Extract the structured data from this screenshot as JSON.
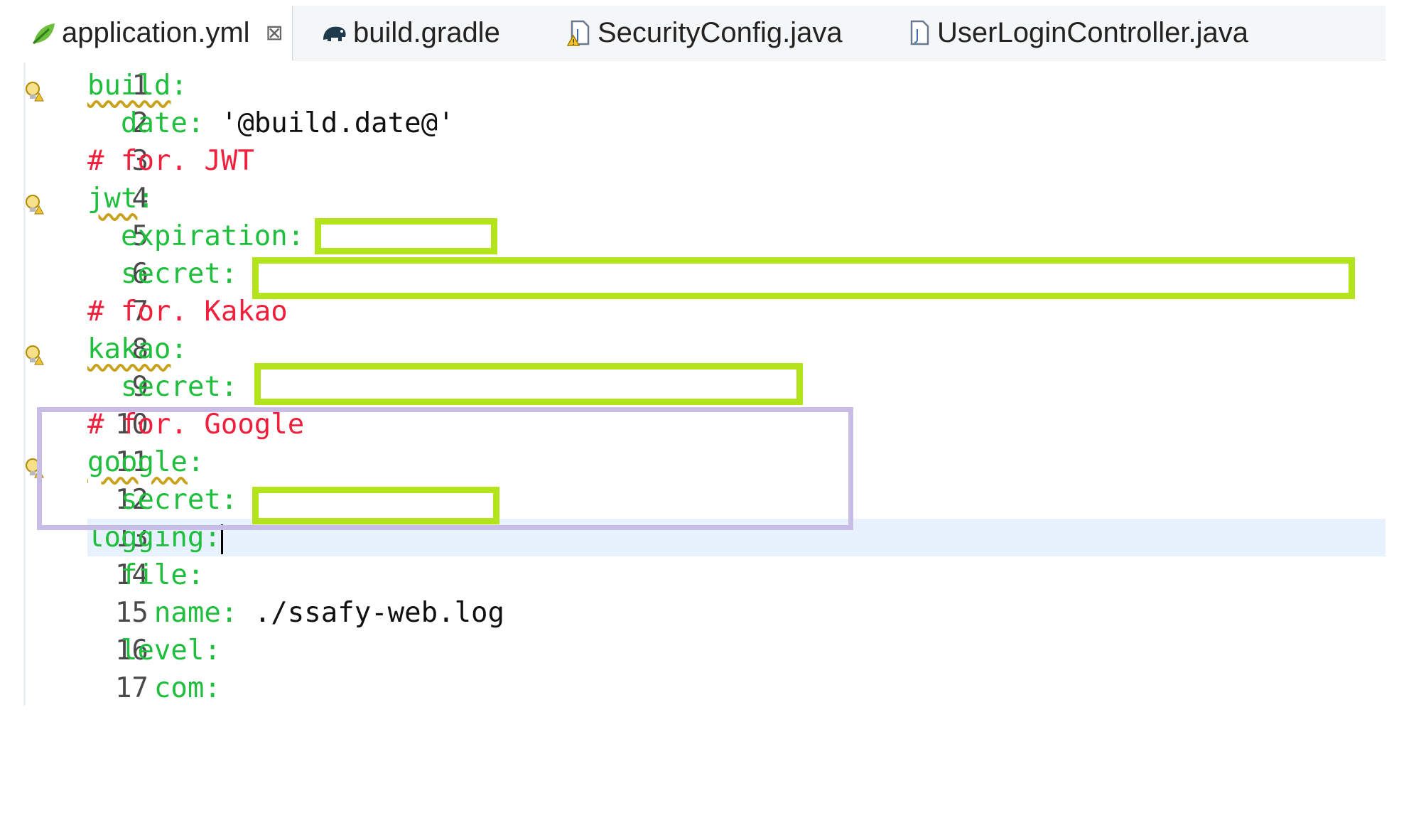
{
  "tabs": [
    {
      "label": "application.yml",
      "icon": "yaml-leaf-icon",
      "active": true,
      "close": "⊠"
    },
    {
      "label": "build.gradle",
      "icon": "gradle-elephant-icon"
    },
    {
      "label": "SecurityConfig.java",
      "icon": "java-file-warning-icon"
    },
    {
      "label": "UserLoginController.java",
      "icon": "java-file-icon"
    }
  ],
  "lines": [
    {
      "n": "1",
      "key": "build",
      "colon": ":"
    },
    {
      "n": "2",
      "key": "  date",
      "colon": ":",
      "value": " '@build.date@'"
    },
    {
      "n": "3",
      "comment": "# for. JWT"
    },
    {
      "n": "4",
      "key": "jwt",
      "colon": ":"
    },
    {
      "n": "5",
      "key": "  expiration",
      "colon": ":"
    },
    {
      "n": "6",
      "key": "  secret",
      "colon": ":"
    },
    {
      "n": "7",
      "comment": "# for. Kakao"
    },
    {
      "n": "8",
      "key": "kakao",
      "colon": ":"
    },
    {
      "n": "9",
      "key": "  secret",
      "colon": ":"
    },
    {
      "n": "10",
      "comment": "# for. Google"
    },
    {
      "n": "11",
      "key": "google",
      "colon": ":"
    },
    {
      "n": "12",
      "key": "  secret",
      "colon": ":"
    },
    {
      "n": "13",
      "key": "logging",
      "colon": ":"
    },
    {
      "n": "14",
      "key": "  file",
      "colon": ":"
    },
    {
      "n": "15",
      "key": "    name",
      "colon": ":",
      "value": " ./ssafy-web.log"
    },
    {
      "n": "16",
      "key": "  level",
      "colon": ":"
    },
    {
      "n": "17",
      "key": "    com",
      "colon": ":"
    }
  ],
  "colors": {
    "key": "#1fbf3d",
    "comment": "#f0203c",
    "redaction_border": "#b3e41b",
    "highlight_border": "#c7bde6",
    "current_line": "#e8f2fe"
  }
}
